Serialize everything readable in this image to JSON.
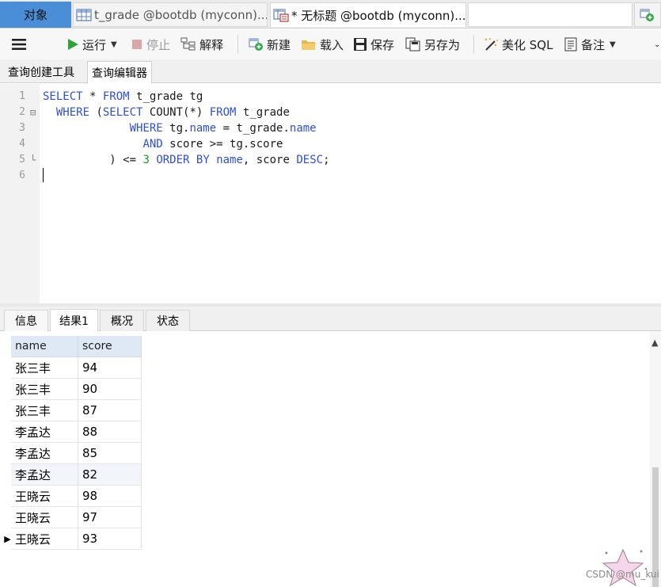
{
  "tabs": {
    "objects_label": "对象",
    "grade_label": "t_grade @bootdb (myconn)...",
    "query_label": "* 无标题 @bootdb (myconn)..."
  },
  "toolbar": {
    "run": "运行",
    "stop": "停止",
    "explain": "解释",
    "new": "新建",
    "load": "载入",
    "save": "保存",
    "save_as": "另存为",
    "beautify": "美化 SQL",
    "comment": "备注"
  },
  "subtabs": {
    "builder": "查询创建工具",
    "editor": "查询编辑器"
  },
  "editor": {
    "lines": [
      {
        "num": "1",
        "fold": "",
        "segments": [
          [
            "kw",
            "SELECT"
          ],
          [
            "t",
            " * "
          ],
          [
            "kw",
            "FROM"
          ],
          [
            "t",
            " t_grade tg"
          ]
        ]
      },
      {
        "num": "2",
        "fold": "⊟",
        "segments": [
          [
            "t",
            "  "
          ],
          [
            "kw",
            "WHERE"
          ],
          [
            "t",
            " ("
          ],
          [
            "kw",
            "SELECT"
          ],
          [
            "t",
            " COUNT(*) "
          ],
          [
            "kw",
            "FROM"
          ],
          [
            "t",
            " t_grade"
          ]
        ]
      },
      {
        "num": "3",
        "fold": "",
        "segments": [
          [
            "t",
            "             "
          ],
          [
            "kw",
            "WHERE"
          ],
          [
            "t",
            " tg."
          ],
          [
            "fld",
            "name"
          ],
          [
            "t",
            " = t_grade."
          ],
          [
            "fld",
            "name"
          ]
        ]
      },
      {
        "num": "4",
        "fold": "",
        "segments": [
          [
            "t",
            "               "
          ],
          [
            "kw",
            "AND"
          ],
          [
            "t",
            " score >= tg.score"
          ]
        ]
      },
      {
        "num": "5",
        "fold": "└",
        "segments": [
          [
            "t",
            "          ) <= "
          ],
          [
            "num",
            "3"
          ],
          [
            "t",
            " "
          ],
          [
            "kw",
            "ORDER BY"
          ],
          [
            "t",
            " "
          ],
          [
            "fld",
            "name"
          ],
          [
            "t",
            ", score "
          ],
          [
            "kw",
            "DESC"
          ],
          [
            "t",
            ";"
          ]
        ]
      },
      {
        "num": "6",
        "fold": "",
        "segments": []
      }
    ]
  },
  "result_tabs": {
    "info": "信息",
    "result1": "结果1",
    "overview": "概况",
    "status": "状态"
  },
  "grid": {
    "columns": [
      "name",
      "score"
    ],
    "rows": [
      [
        "张三丰",
        "94"
      ],
      [
        "张三丰",
        "90"
      ],
      [
        "张三丰",
        "87"
      ],
      [
        "李孟达",
        "88"
      ],
      [
        "李孟达",
        "85"
      ],
      [
        "李孟达",
        "82"
      ],
      [
        "王晓云",
        "98"
      ],
      [
        "王晓云",
        "97"
      ],
      [
        "王晓云",
        "93"
      ]
    ]
  },
  "watermark": "CSDN @mu_kui"
}
